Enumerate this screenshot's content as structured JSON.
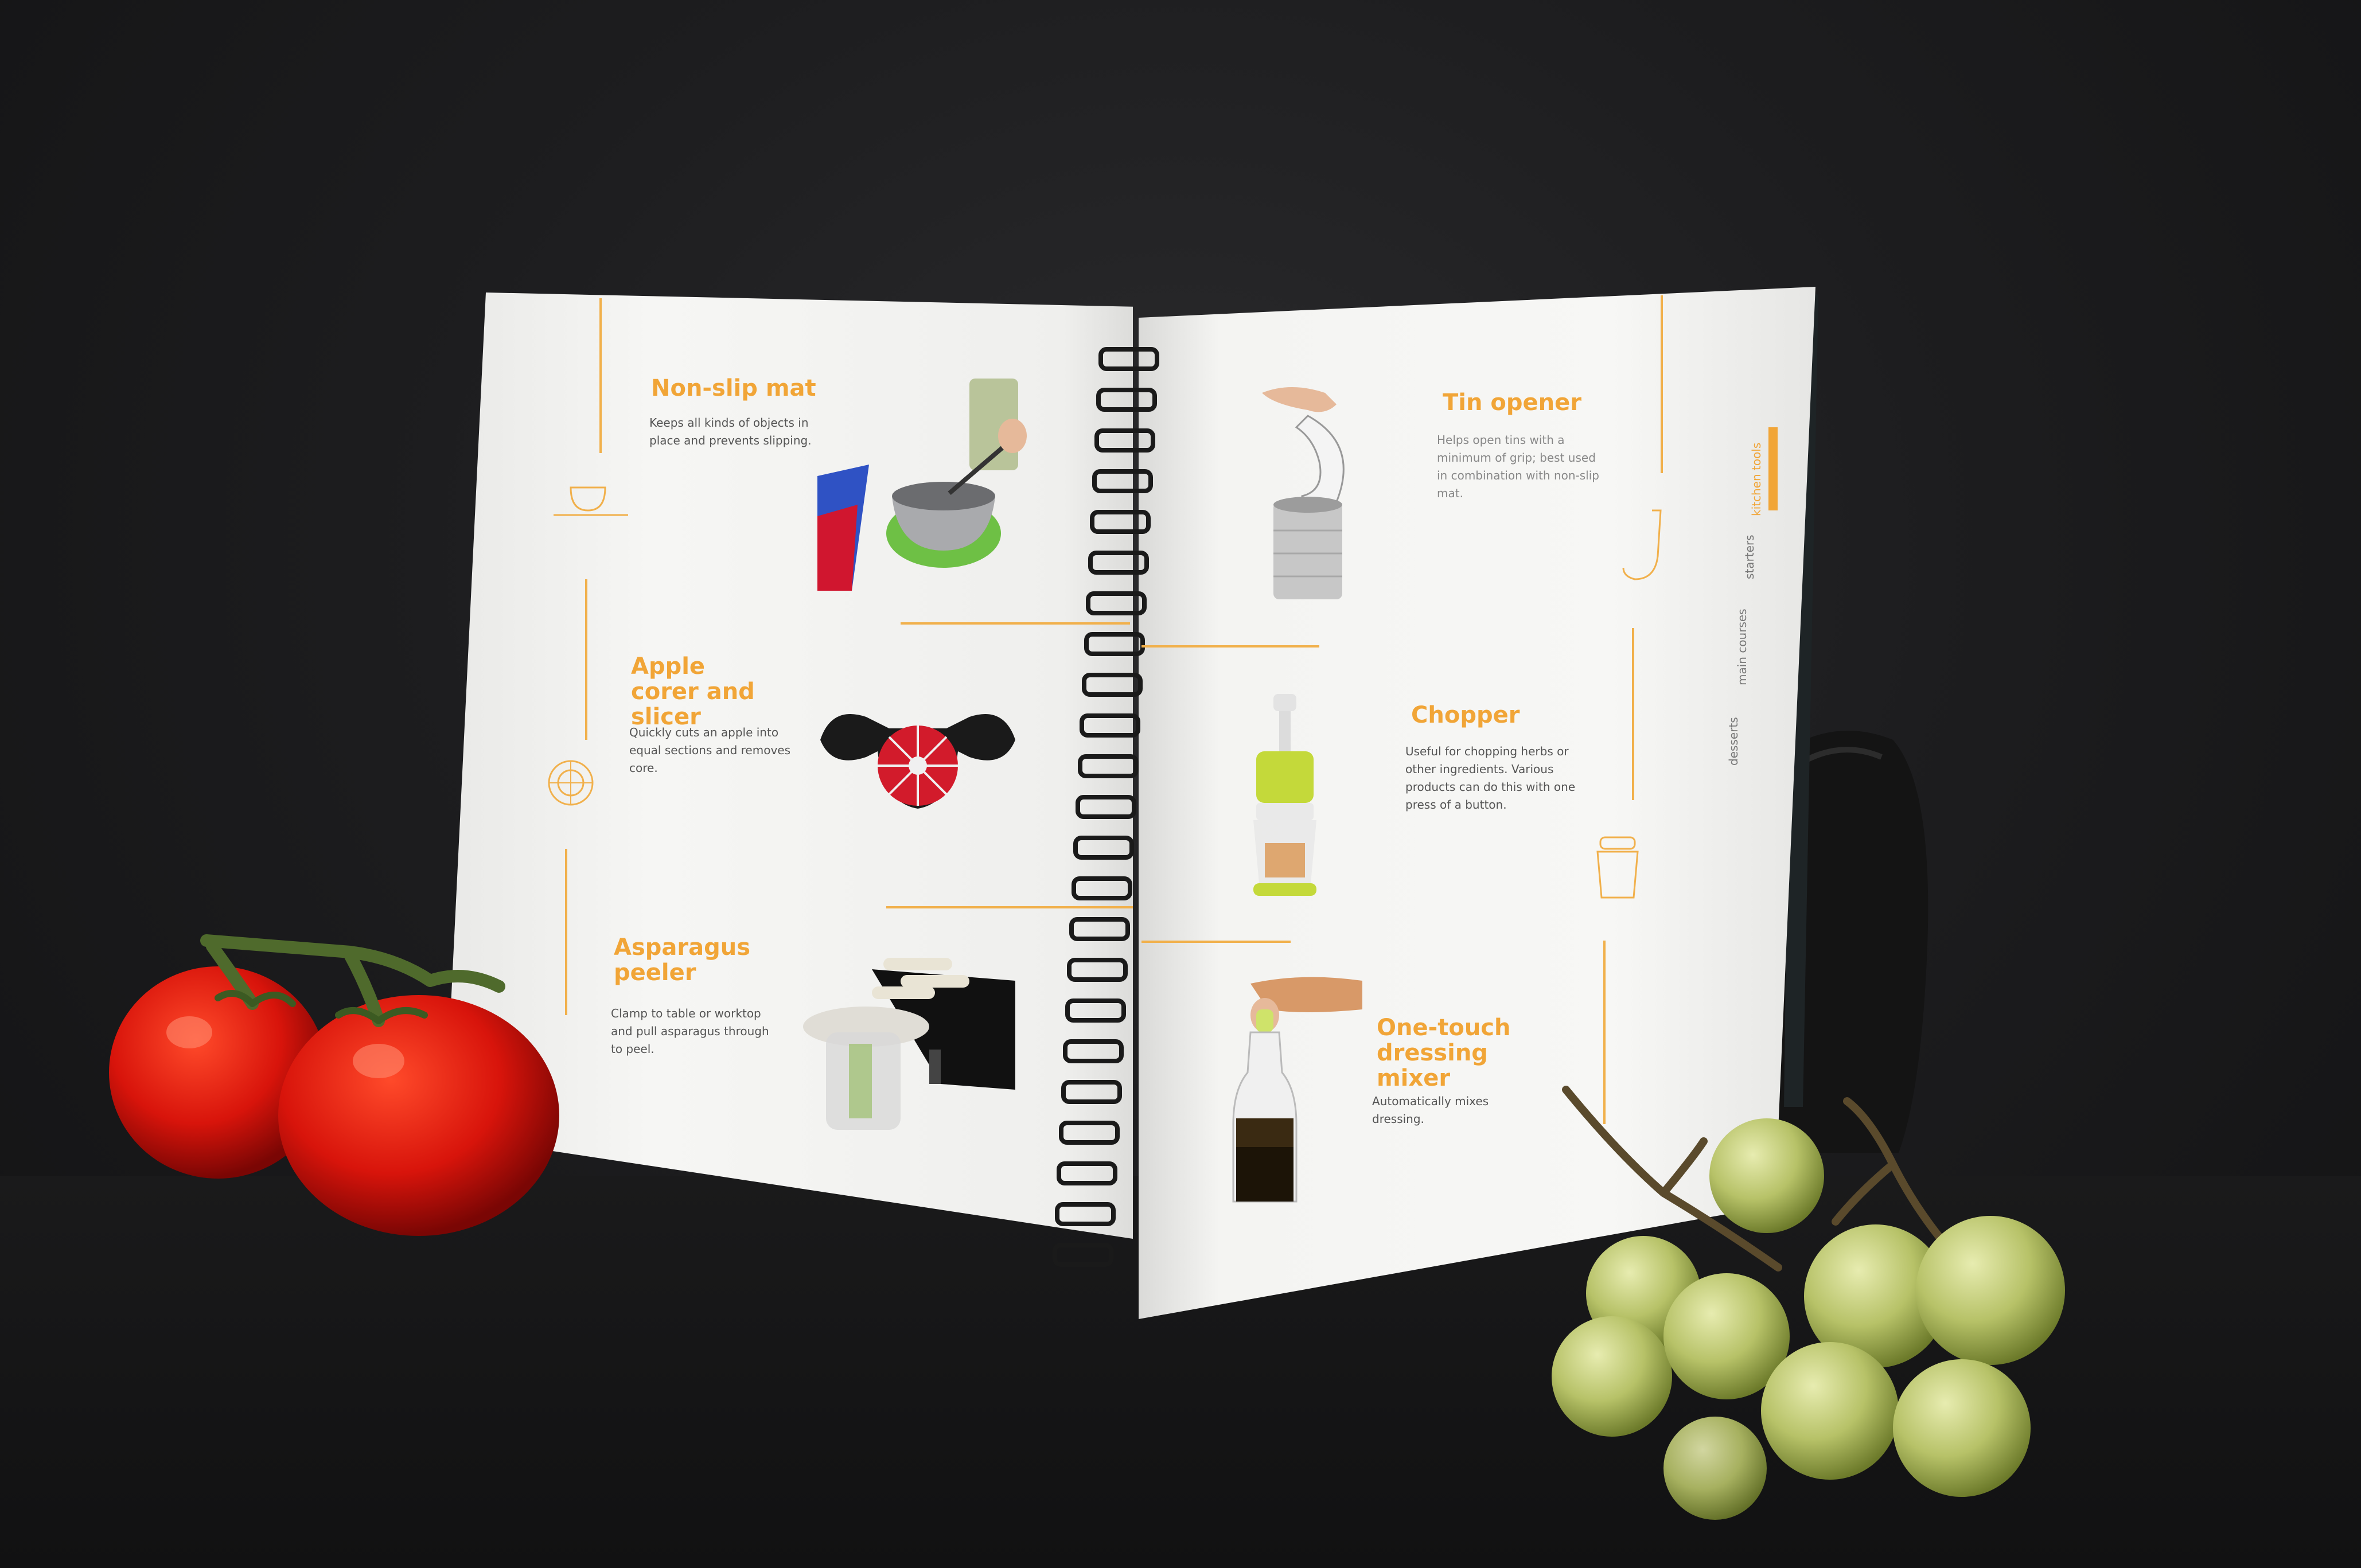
{
  "left_page": {
    "tools": [
      {
        "title": "Non-slip mat",
        "desc": "Keeps all kinds of objects in place and prevents slipping."
      },
      {
        "title": "Apple corer and slicer",
        "desc": "Quickly cuts an apple into equal sections and removes core."
      },
      {
        "title": "Asparagus peeler",
        "desc": "Clamp to table or worktop and pull asparagus through to peel."
      }
    ]
  },
  "right_page": {
    "tools": [
      {
        "title": "Tin opener",
        "desc": "Helps open tins with a minimum of grip; best used in combination with non-slip mat."
      },
      {
        "title": "Chopper",
        "desc": "Useful for chopping herbs or other ingredients. Various products can do this with one press of a button."
      },
      {
        "title": "One-touch dressing mixer",
        "desc": "Automatically mixes dressing."
      }
    ],
    "tabs": [
      "kitchen tools",
      "starters",
      "main courses",
      "desserts"
    ]
  },
  "colors": {
    "accent": "#f1a537",
    "page": "#f4f4f2",
    "background": "#1d1d1f"
  }
}
